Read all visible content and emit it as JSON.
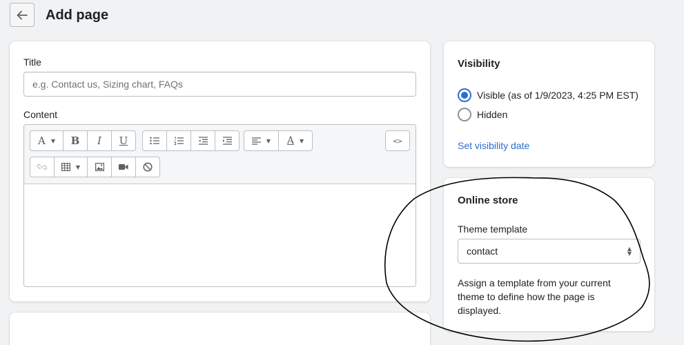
{
  "header": {
    "title": "Add page",
    "back_icon": "arrow-left-icon"
  },
  "main_card": {
    "title_label": "Title",
    "title_placeholder": "e.g. Contact us, Sizing chart, FAQs",
    "title_value": "",
    "content_label": "Content",
    "toolbar": {
      "row1": [
        {
          "name": "font-format-dropdown",
          "glyph": "A",
          "dropdown": true
        },
        {
          "name": "bold",
          "glyph": "B"
        },
        {
          "name": "italic",
          "glyph": "I"
        },
        {
          "name": "underline",
          "glyph": "U"
        },
        {
          "name": "bulleted-list",
          "icon": "bulleted-list-icon"
        },
        {
          "name": "numbered-list",
          "icon": "numbered-list-icon"
        },
        {
          "name": "outdent",
          "icon": "outdent-icon"
        },
        {
          "name": "indent",
          "icon": "indent-icon"
        },
        {
          "name": "align-dropdown",
          "icon": "align-left-icon",
          "dropdown": true
        },
        {
          "name": "text-color-dropdown",
          "glyph": "A",
          "dropdown": true
        },
        {
          "name": "show-html",
          "glyph": "<>"
        }
      ],
      "row2": [
        {
          "name": "insert-link",
          "icon": "link-icon",
          "disabled": true
        },
        {
          "name": "insert-table-dropdown",
          "icon": "table-icon",
          "dropdown": true
        },
        {
          "name": "insert-image",
          "icon": "image-icon"
        },
        {
          "name": "insert-video",
          "icon": "video-icon"
        },
        {
          "name": "clear-formatting",
          "icon": "clear-format-icon"
        }
      ]
    },
    "content_value": ""
  },
  "visibility_card": {
    "title": "Visibility",
    "options": [
      {
        "label": "Visible (as of 1/9/2023, 4:25 PM EST)",
        "checked": true
      },
      {
        "label": "Hidden",
        "checked": false
      }
    ],
    "link": "Set visibility date"
  },
  "online_store_card": {
    "title": "Online store",
    "template_label": "Theme template",
    "template_value": "contact",
    "help_text": "Assign a template from your current theme to define how the page is displayed."
  },
  "colors": {
    "accent": "#2c6ecb",
    "background": "#f1f2f3",
    "annotation": "#000000"
  }
}
